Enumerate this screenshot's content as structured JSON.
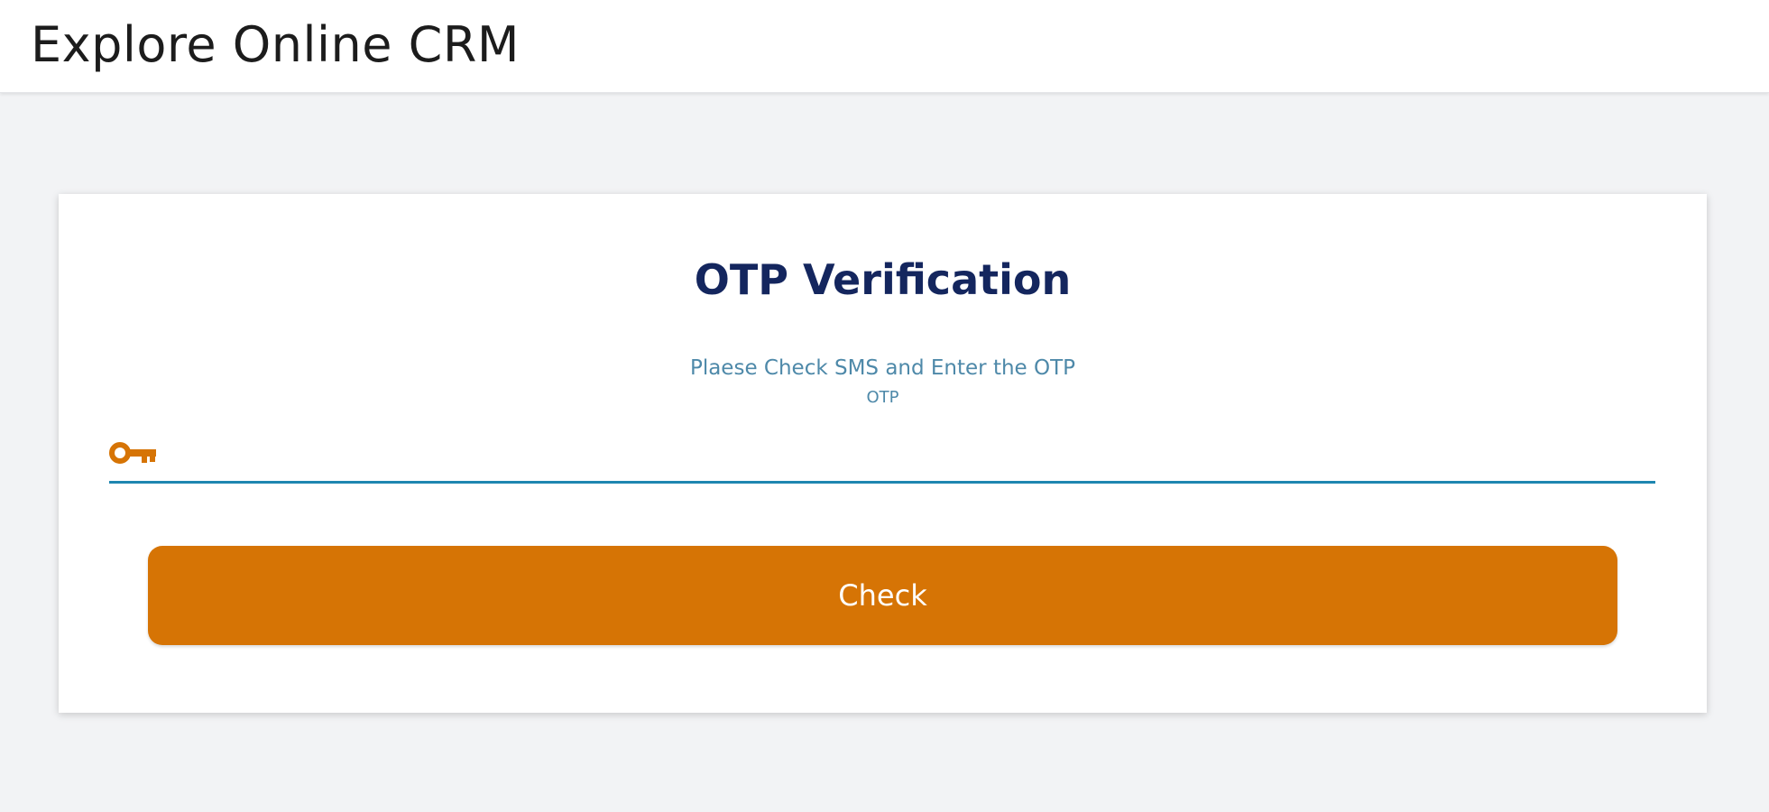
{
  "header": {
    "title": "Explore Online CRM"
  },
  "card": {
    "title": "OTP Verification",
    "subtitle": "Plaese Check SMS and Enter the OTP",
    "field_label": "OTP",
    "input_value": "",
    "key_icon": "key-icon",
    "check_label": "Check"
  },
  "colors": {
    "accent": "#d67405",
    "title": "#14265e",
    "subtitle": "#4e89a9",
    "underline": "#1e86b0",
    "background": "#f2f3f5"
  }
}
